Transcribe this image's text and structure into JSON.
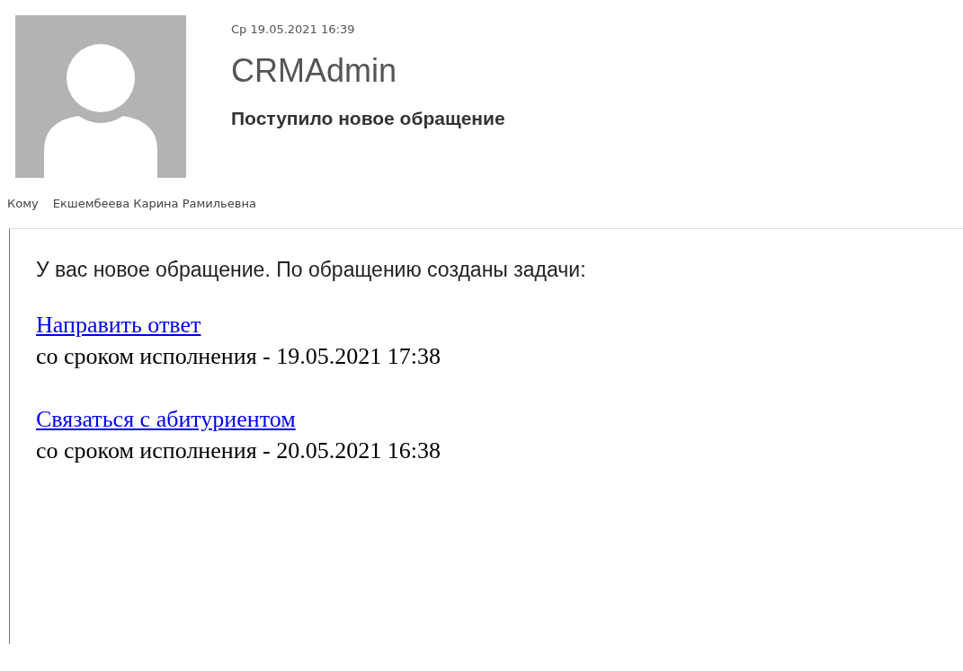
{
  "message": {
    "date": "Ср 19.05.2021 16:39",
    "sender": "CRMAdmin",
    "subject": "Поступило новое обращение",
    "to_label": "Кому",
    "to": "Екшембеева Карина Рамильевна"
  },
  "body": {
    "intro": "У вас новое обращение. По обращению созданы задачи:",
    "tasks": [
      {
        "link": "Направить ответ",
        "deadline": "со сроком исполнения -  19.05.2021 17:38"
      },
      {
        "link": "Связаться с абитуриентом",
        "deadline": "со сроком исполнения -  20.05.2021 16:38"
      }
    ]
  }
}
